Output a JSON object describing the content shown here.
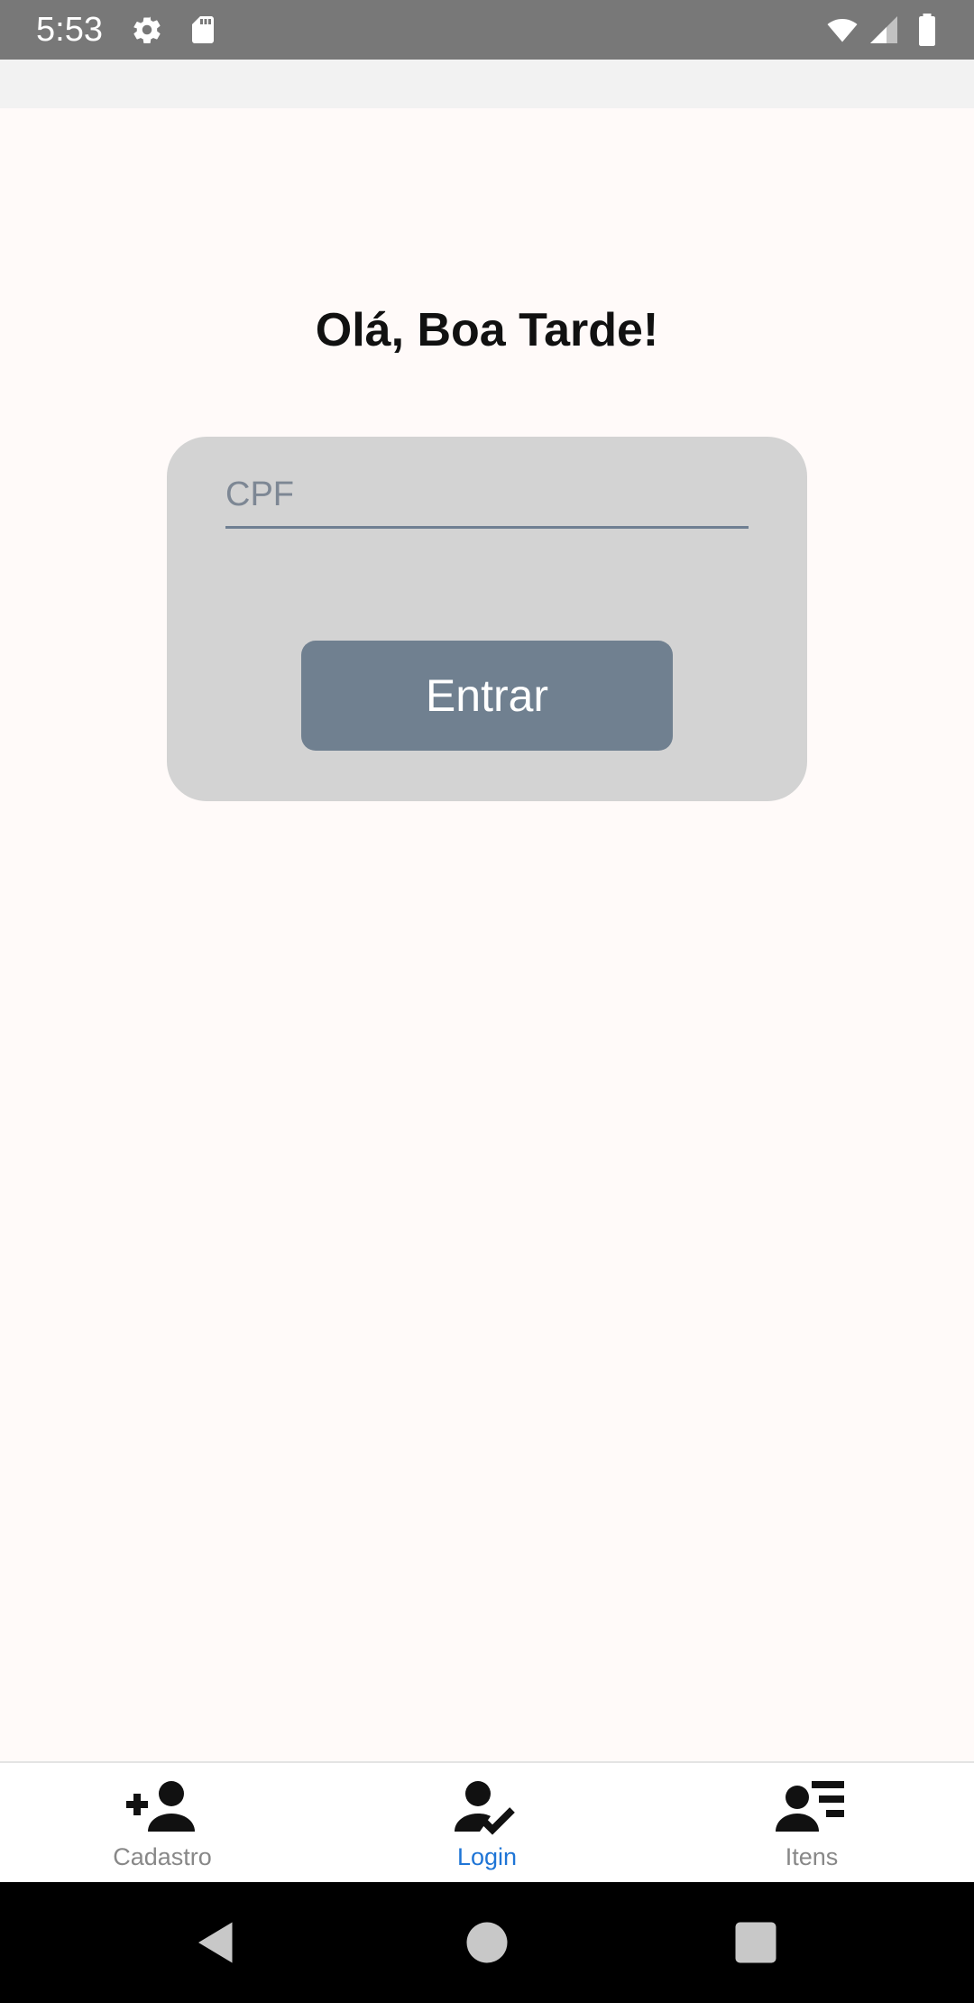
{
  "status_bar": {
    "time": "5:53",
    "icons": [
      "gear-icon",
      "sd-card-icon",
      "wifi-icon",
      "cell-signal-icon",
      "battery-icon"
    ]
  },
  "screen": {
    "greeting": "Olá, Boa Tarde!"
  },
  "login_form": {
    "cpf_placeholder": "CPF",
    "cpf_value": "",
    "submit_label": "Entrar"
  },
  "tab_bar": {
    "active_tab": "Login",
    "active_color": "#1f75d6",
    "inactive_color": "#888888",
    "tabs": [
      {
        "label": "Cadastro",
        "icon": "add-person-icon"
      },
      {
        "label": "Login",
        "icon": "person-check-icon"
      },
      {
        "label": "Itens",
        "icon": "person-list-icon"
      }
    ]
  },
  "nav_bar": {
    "buttons": [
      "back-triangle-icon",
      "home-circle-icon",
      "recents-square-icon"
    ]
  },
  "colors": {
    "background": "#fffaf9",
    "card": "#d3d3d3",
    "button": "#708090",
    "status_bar": "#787878"
  }
}
